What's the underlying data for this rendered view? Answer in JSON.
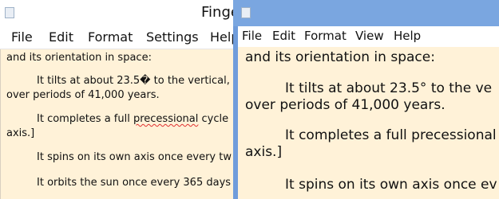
{
  "left_window": {
    "title": "Finge",
    "menu": [
      "File",
      "Edit",
      "Format",
      "Settings",
      "Help"
    ],
    "lines": {
      "l1": "and its orientation in space:",
      "l2": "It tilts at about 23.5\u0000 to the vertical,",
      "l3": "over periods of 41,000 years.",
      "l4a": "It completes a full ",
      "l4b": "precessional",
      "l4c": " cycle",
      "l5": "axis.]",
      "l6": "It spins on its own axis once every tw",
      "l7": "It orbits the sun once every 365 days"
    }
  },
  "right_window": {
    "menu": [
      "File",
      "Edit",
      "Format",
      "View",
      "Help"
    ],
    "lines": {
      "l1": "and its orientation in space:",
      "l2": "It tilts at about 23.5° to the ve",
      "l3": "over periods of 41,000 years.",
      "l4": "It completes a full precessional",
      "l5": "axis.]",
      "l6": "It spins on its own axis once ev"
    }
  }
}
